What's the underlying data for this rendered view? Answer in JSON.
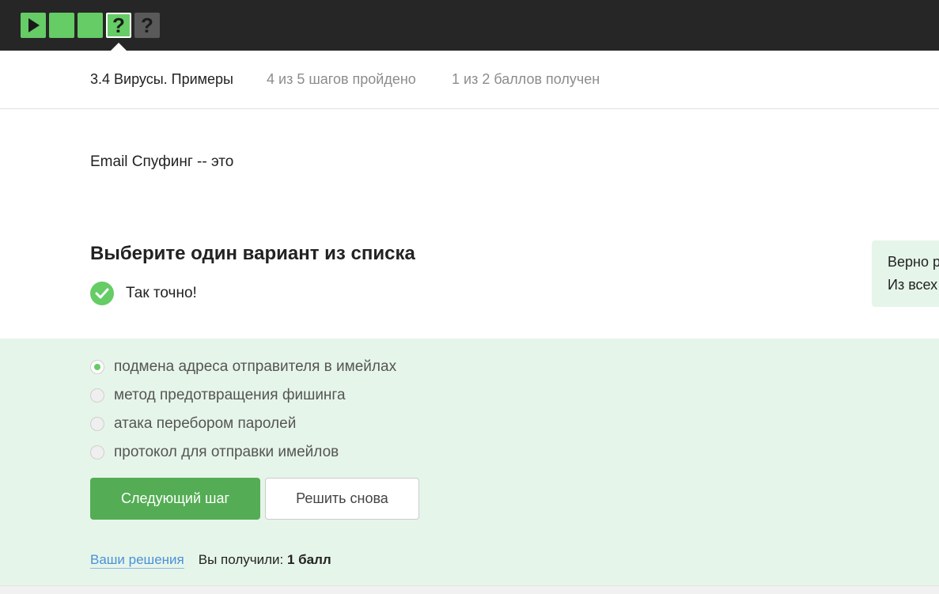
{
  "steps": {
    "items": [
      {
        "icon": "play-icon",
        "status": "passed",
        "label": ""
      },
      {
        "icon": "",
        "status": "passed",
        "label": ""
      },
      {
        "icon": "",
        "status": "passed",
        "label": ""
      },
      {
        "icon": "",
        "status": "current",
        "label": "?"
      },
      {
        "icon": "",
        "status": "pending",
        "label": "?"
      }
    ]
  },
  "lesson": {
    "title": "3.4 Вирусы. Примеры",
    "progress": "4 из 5 шагов пройдено",
    "score": "1 из 2 баллов  получен"
  },
  "question": {
    "text": "Email Спуфинг -- это",
    "instruction": "Выберите один вариант из списка",
    "feedback": "Так точно!"
  },
  "hint": {
    "line1": "Верно р",
    "line2": "Из всех"
  },
  "options": [
    {
      "label": "подмена адреса отправителя в имейлах",
      "selected": true
    },
    {
      "label": "метод предотвращения фишинга",
      "selected": false
    },
    {
      "label": "атака перебором паролей",
      "selected": false
    },
    {
      "label": "протокол для отправки имейлов",
      "selected": false
    }
  ],
  "buttons": {
    "next": "Следующий шаг",
    "retry": "Решить снова"
  },
  "footer": {
    "solutions_link": "Ваши решения",
    "received_prefix": "Вы получили:",
    "received_value": "1 балл"
  },
  "colors": {
    "success": "#66cc66",
    "button_green": "#54ad54",
    "answer_bg": "#e6f5e9",
    "topbar": "#262626",
    "link": "#4a90d9"
  }
}
